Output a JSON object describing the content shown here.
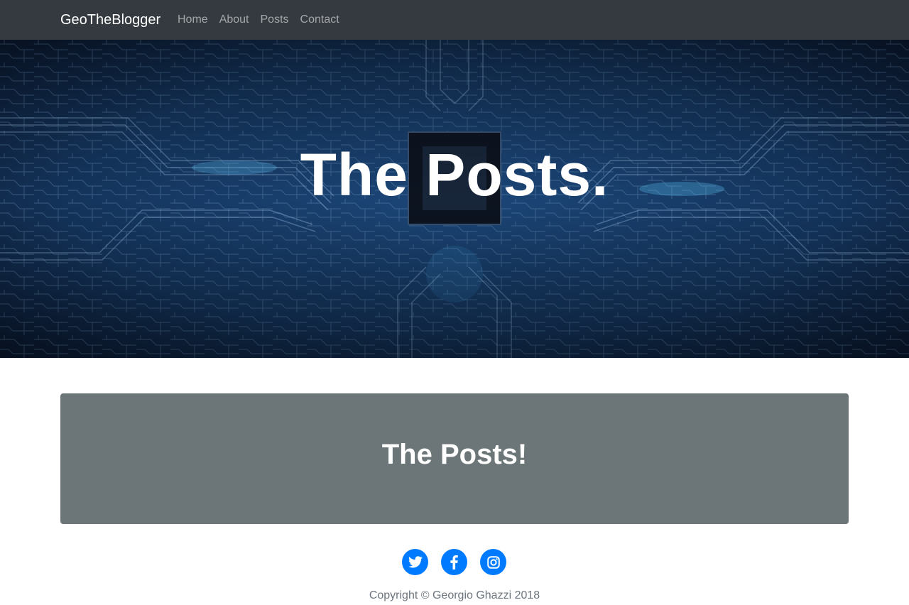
{
  "navbar": {
    "brand": "GeoTheBlogger",
    "links": [
      {
        "label": "Home"
      },
      {
        "label": "About"
      },
      {
        "label": "Posts"
      },
      {
        "label": "Contact"
      }
    ]
  },
  "hero": {
    "title": "The Posts."
  },
  "jumbotron": {
    "title": "The Posts!"
  },
  "social": [
    {
      "icon": "twitter-icon"
    },
    {
      "icon": "facebook-icon"
    },
    {
      "icon": "instagram-icon"
    }
  ],
  "footer": {
    "copyright": "Copyright © Georgio Ghazzi 2018"
  },
  "colors": {
    "navbar_bg": "#343a40",
    "hero_bg": "#0b1a33",
    "jumbotron_bg": "#6c7678",
    "social_bg": "#007bff",
    "copyright_text": "#6c757d"
  }
}
